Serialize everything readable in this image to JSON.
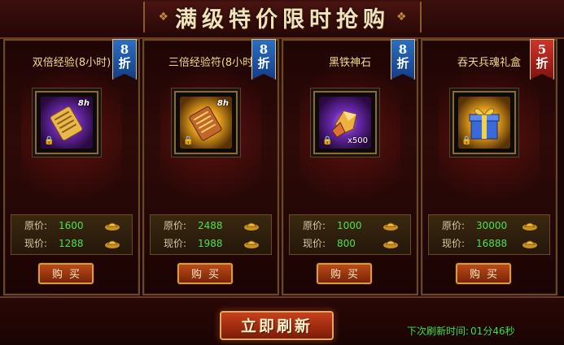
{
  "title": "满级特价限时抢购",
  "title_deco_left": "❖",
  "title_deco_right": "❖",
  "labels": {
    "original_price": "原价:",
    "current_price": "现价:"
  },
  "cards": [
    {
      "name": "双倍经验(8小时)",
      "discount_number": "8",
      "discount_unit": "折",
      "badge_color": "blue",
      "icon": "double-exp-scroll-icon",
      "icon_theme": "purple",
      "overlay_text": "8h",
      "quantity": "",
      "original_price": "1600",
      "current_price": "1288",
      "buy_label": "购买"
    },
    {
      "name": "三倍经验符(8小时",
      "discount_number": "8",
      "discount_unit": "折",
      "badge_color": "blue",
      "icon": "triple-exp-scroll-icon",
      "icon_theme": "gold",
      "overlay_text": "8h",
      "quantity": "",
      "original_price": "2488",
      "current_price": "1988",
      "buy_label": "购买"
    },
    {
      "name": "黑铁神石",
      "discount_number": "8",
      "discount_unit": "折",
      "badge_color": "blue",
      "icon": "black-iron-stone-icon",
      "icon_theme": "purple",
      "overlay_text": "",
      "quantity": "x500",
      "original_price": "1000",
      "current_price": "800",
      "buy_label": "购买"
    },
    {
      "name": "吞天兵魂礼盒",
      "discount_number": "5",
      "discount_unit": "折",
      "badge_color": "red",
      "icon": "gift-box-icon",
      "icon_theme": "gold",
      "overlay_text": "",
      "quantity": "",
      "original_price": "30000",
      "current_price": "16888",
      "buy_label": "购买"
    }
  ],
  "refresh_button": "立即刷新",
  "timer": {
    "label": "下次刷新时间:",
    "value": "01分46秒"
  },
  "colors": {
    "price_green": "#4ee04e",
    "timer_green": "#3ce03c",
    "badge_blue": "#2b6fc2",
    "badge_red": "#d0342a"
  }
}
